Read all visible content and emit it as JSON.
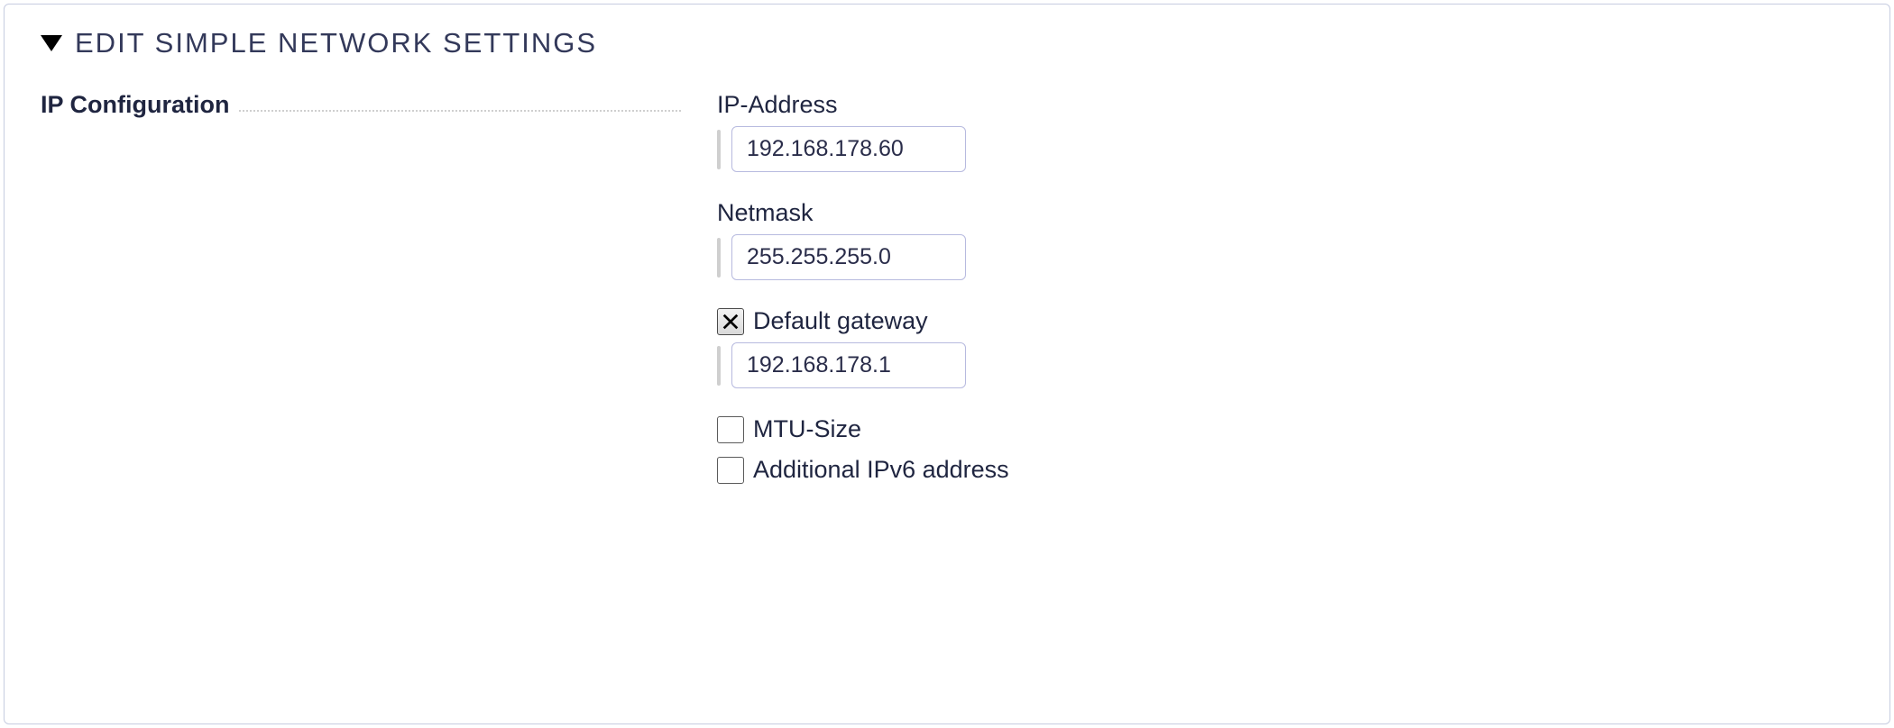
{
  "panel": {
    "title": "EDIT SIMPLE NETWORK SETTINGS"
  },
  "section": {
    "label": "IP Configuration"
  },
  "fields": {
    "ip_address": {
      "label": "IP-Address",
      "value": "192.168.178.60"
    },
    "netmask": {
      "label": "Netmask",
      "value": "255.255.255.0"
    },
    "default_gateway": {
      "label": "Default gateway",
      "checked": true,
      "value": "192.168.178.1"
    },
    "mtu_size": {
      "label": "MTU-Size",
      "checked": false
    },
    "additional_ipv6": {
      "label": "Additional IPv6 address",
      "checked": false
    }
  }
}
